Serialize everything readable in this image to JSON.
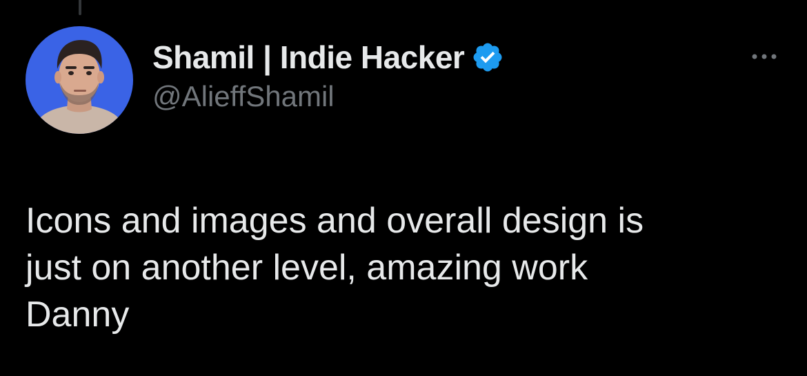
{
  "tweet": {
    "author": {
      "display_name": "Shamil | Indie Hacker",
      "handle": "@AlieffShamil",
      "verified": true,
      "avatar_icon": "person-avatar",
      "avatar_bg": "#3a63e6"
    },
    "text": "Icons and images and overall design is\njust on another level, amazing work\nDanny",
    "more_icon": "more-horizontal-icon"
  },
  "colors": {
    "background": "#000000",
    "primary_text": "#e7e9ea",
    "secondary_text": "#71767b",
    "verified_blue": "#1d9bf0",
    "thread_line": "#333639"
  }
}
